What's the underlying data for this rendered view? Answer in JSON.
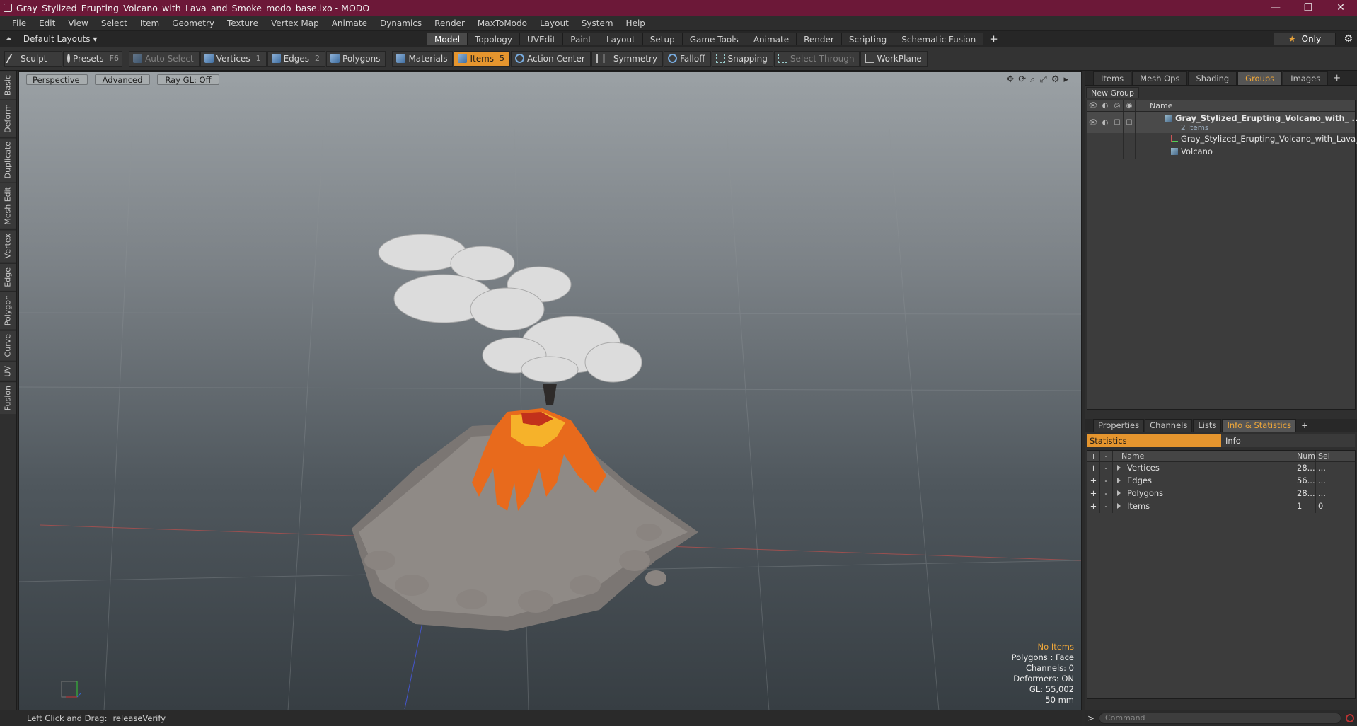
{
  "window": {
    "title": "Gray_Stylized_Erupting_Volcano_with_Lava_and_Smoke_modo_base.lxo - MODO",
    "minimize": "—",
    "maximize": "❐",
    "close": "✕"
  },
  "menu": [
    "File",
    "Edit",
    "View",
    "Select",
    "Item",
    "Geometry",
    "Texture",
    "Vertex Map",
    "Animate",
    "Dynamics",
    "Render",
    "MaxToModo",
    "Layout",
    "System",
    "Help"
  ],
  "layoutbar": {
    "layouts_dropdown": "Default Layouts ▾",
    "tabs": [
      "Model",
      "Topology",
      "UVEdit",
      "Paint",
      "Layout",
      "Setup",
      "Game Tools",
      "Animate",
      "Render",
      "Scripting",
      "Schematic Fusion"
    ],
    "active_tab": "Model",
    "add": "+",
    "only_label": "Only",
    "star": "★",
    "gear": "⚙"
  },
  "toolbar": {
    "sculpt": "Sculpt",
    "presets": "Presets",
    "presets_key": "F6",
    "auto_select": "Auto Select",
    "vertices": "Vertices",
    "vertices_num": "1",
    "edges": "Edges",
    "edges_num": "2",
    "polygons": "Polygons",
    "materials": "Materials",
    "items": "Items",
    "items_num": "5",
    "action_center": "Action Center",
    "symmetry": "Symmetry",
    "falloff": "Falloff",
    "snapping": "Snapping",
    "select_through": "Select Through",
    "workplane": "WorkPlane"
  },
  "left_tabs": [
    "Basic",
    "Deform",
    "Duplicate",
    "Mesh Edit",
    "Vertex",
    "Edge",
    "Polygon",
    "Curve",
    "UV",
    "Fusion"
  ],
  "viewport": {
    "perspective": "Perspective",
    "advanced": "Advanced",
    "raygl": "Ray GL: Off",
    "info": {
      "no_items": "No Items",
      "polygons": "Polygons : Face",
      "channels": "Channels: 0",
      "deformers": "Deformers: ON",
      "gl": "GL: 55,002",
      "focal": "50 mm"
    }
  },
  "statusbar": {
    "hint": "Left Click and Drag:",
    "value": "releaseVerify"
  },
  "groups_panel": {
    "tabs": [
      "Items",
      "Mesh Ops",
      "Shading",
      "Groups",
      "Images"
    ],
    "active_tab": "Groups",
    "add": "+",
    "new_group": "New Group",
    "name_header": "Name",
    "group_name": "Gray_Stylized_Erupting_Volcano_with_ ...",
    "group_count": "2 Items",
    "child_1": "Gray_Stylized_Erupting_Volcano_with_Lava_...",
    "child_2": "Volcano"
  },
  "stats_panel": {
    "tabs": [
      "Properties",
      "Channels",
      "Lists",
      "Info & Statistics"
    ],
    "active_tab": "Info & Statistics",
    "add": "+",
    "statistics": "Statistics",
    "info": "Info",
    "headers": {
      "name": "Name",
      "num": "Num",
      "sel": "Sel"
    },
    "rows": [
      {
        "name": "Vertices",
        "num": "28....",
        "sel": "..."
      },
      {
        "name": "Edges",
        "num": "56....",
        "sel": "..."
      },
      {
        "name": "Polygons",
        "num": "28....",
        "sel": "..."
      },
      {
        "name": "Items",
        "num": "1",
        "sel": "0"
      }
    ]
  },
  "command": {
    "prompt": ">",
    "placeholder": "Command"
  },
  "colors": {
    "titlebar": "#6c1838",
    "accent": "#e5952e",
    "highlight_text": "#f0a83a"
  }
}
